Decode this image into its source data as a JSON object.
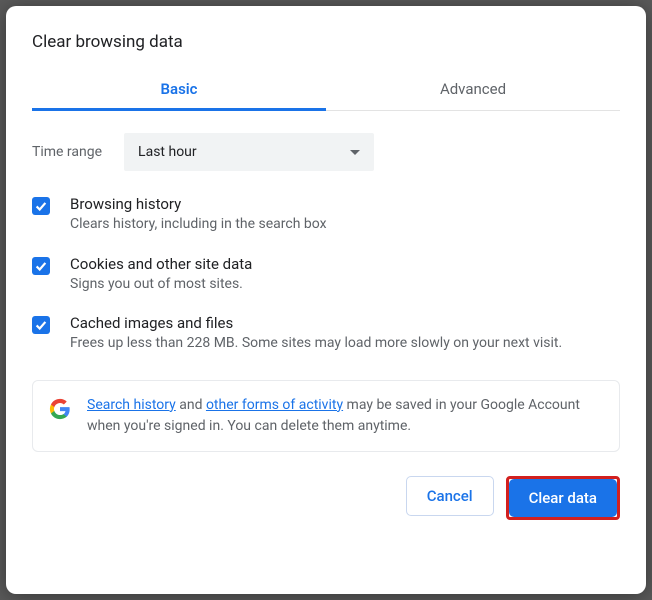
{
  "dialog": {
    "title": "Clear browsing data"
  },
  "tabs": {
    "basic": "Basic",
    "advanced": "Advanced"
  },
  "timeRange": {
    "label": "Time range",
    "value": "Last hour"
  },
  "options": {
    "history": {
      "title": "Browsing history",
      "sub": "Clears history, including in the search box"
    },
    "cookies": {
      "title": "Cookies and other site data",
      "sub": "Signs you out of most sites."
    },
    "cache": {
      "title": "Cached images and files",
      "sub": "Frees up less than 228 MB. Some sites may load more slowly on your next visit."
    }
  },
  "info": {
    "link1": "Search history",
    "mid1": " and ",
    "link2": "other forms of activity",
    "rest": " may be saved in your Google Account when you're signed in. You can delete them anytime."
  },
  "buttons": {
    "cancel": "Cancel",
    "clear": "Clear data"
  }
}
